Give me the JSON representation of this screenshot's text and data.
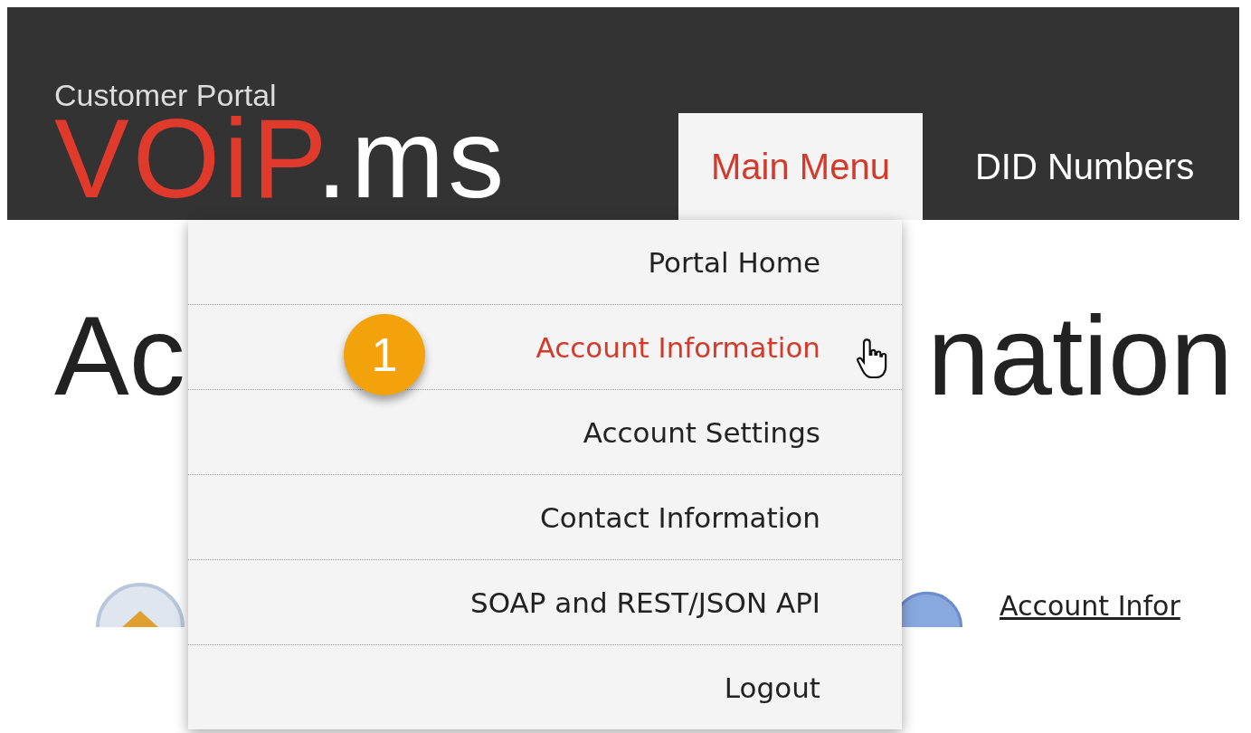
{
  "header": {
    "subtitle": "Customer Portal",
    "logo": {
      "part_1": "VOiP",
      "part_2": ".ms"
    }
  },
  "tabs": [
    {
      "label": "Main Menu",
      "selected": true
    },
    {
      "label": "DID Numbers",
      "selected": false
    }
  ],
  "heading": {
    "left": "Ac",
    "right": "nation"
  },
  "menu": {
    "items": [
      {
        "label": "Portal Home",
        "selected": false
      },
      {
        "label": "Account Information",
        "selected": true
      },
      {
        "label": "Account Settings",
        "selected": false
      },
      {
        "label": "Contact Information",
        "selected": false
      },
      {
        "label": "SOAP and REST/JSON API",
        "selected": false
      },
      {
        "label": "Logout",
        "selected": false
      }
    ]
  },
  "step_badge": "1",
  "link": "Account Infor"
}
